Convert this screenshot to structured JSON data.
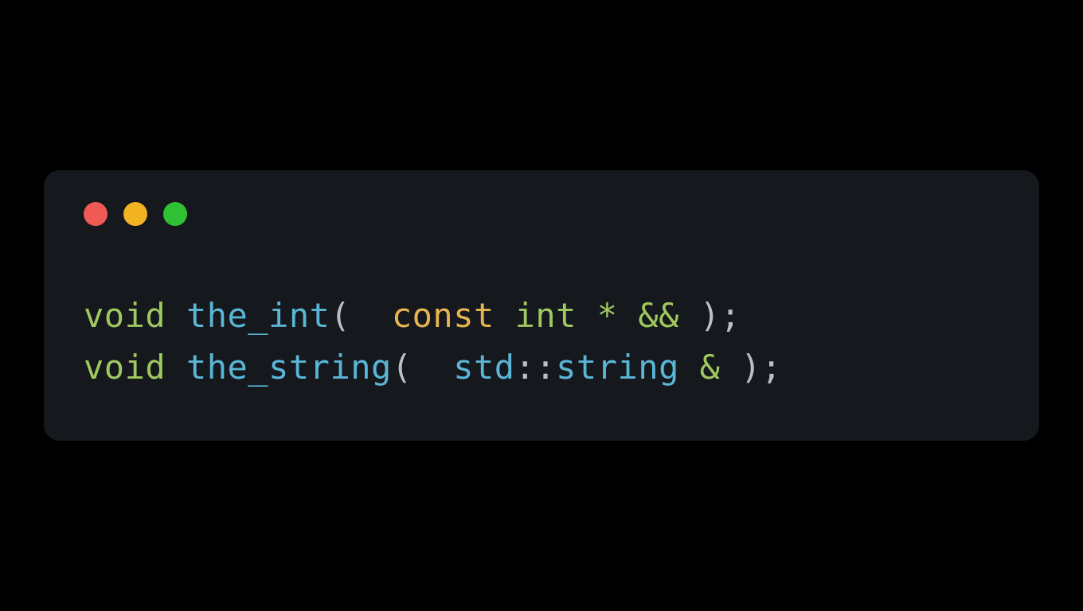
{
  "window": {
    "controls": {
      "close": "close",
      "minimize": "minimize",
      "maximize": "maximize"
    }
  },
  "code": {
    "lines": [
      {
        "tokens": [
          {
            "text": "void",
            "class": "tok-keyword"
          },
          {
            "text": " ",
            "class": ""
          },
          {
            "text": "the_int",
            "class": "tok-function"
          },
          {
            "text": "(",
            "class": "tok-punct"
          },
          {
            "text": "  ",
            "class": ""
          },
          {
            "text": "const",
            "class": "tok-const"
          },
          {
            "text": " ",
            "class": ""
          },
          {
            "text": "int",
            "class": "tok-type"
          },
          {
            "text": " ",
            "class": ""
          },
          {
            "text": "*",
            "class": "tok-operator"
          },
          {
            "text": " ",
            "class": ""
          },
          {
            "text": "&&",
            "class": "tok-operator"
          },
          {
            "text": " ",
            "class": ""
          },
          {
            "text": ")",
            "class": "tok-punct"
          },
          {
            "text": ";",
            "class": "tok-punct"
          }
        ]
      },
      {
        "tokens": [
          {
            "text": "void",
            "class": "tok-keyword"
          },
          {
            "text": " ",
            "class": ""
          },
          {
            "text": "the_string",
            "class": "tok-function"
          },
          {
            "text": "(",
            "class": "tok-punct"
          },
          {
            "text": "  ",
            "class": ""
          },
          {
            "text": "std",
            "class": "tok-namespace"
          },
          {
            "text": "::",
            "class": "tok-punct"
          },
          {
            "text": "string",
            "class": "tok-namespace"
          },
          {
            "text": " ",
            "class": ""
          },
          {
            "text": "&",
            "class": "tok-operator"
          },
          {
            "text": " ",
            "class": ""
          },
          {
            "text": ")",
            "class": "tok-punct"
          },
          {
            "text": ";",
            "class": "tok-punct"
          }
        ]
      }
    ]
  }
}
